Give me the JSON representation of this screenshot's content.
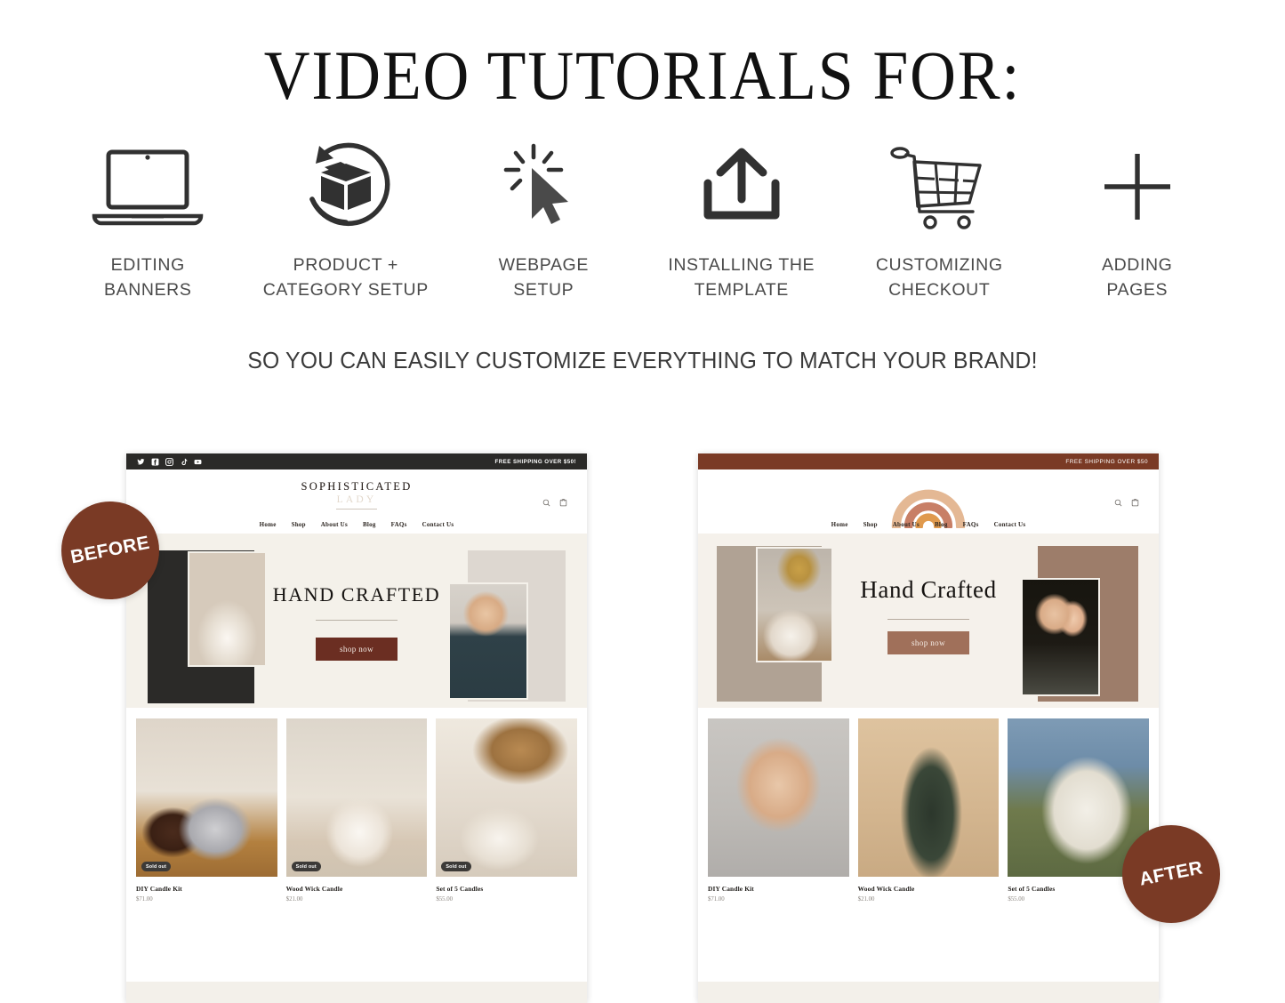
{
  "header": {
    "title": "VIDEO TUTORIALS FOR:",
    "subtitle": "SO YOU CAN EASILY CUSTOMIZE EVERYTHING TO MATCH YOUR BRAND!"
  },
  "features": [
    {
      "icon": "laptop-icon",
      "label": "EDITING\nBANNERS"
    },
    {
      "icon": "box-refresh-icon",
      "label": "PRODUCT +\nCATEGORY SETUP"
    },
    {
      "icon": "cursor-click-icon",
      "label": "WEBPAGE\nSETUP"
    },
    {
      "icon": "upload-icon",
      "label": "INSTALLING THE\nTEMPLATE"
    },
    {
      "icon": "shopping-cart-icon",
      "label": "CUSTOMIZING\nCHECKOUT"
    },
    {
      "icon": "plus-icon",
      "label": "ADDING\nPAGES"
    }
  ],
  "badges": {
    "before": "BEFORE",
    "after": "AFTER"
  },
  "colors": {
    "badge_brown": "#7a3a25",
    "before_bar": "#2b2a28",
    "after_bar": "#7a3a25",
    "before_button": "#6b2e22",
    "after_button": "#a0705a",
    "hero_bg": "#f4f1ea"
  },
  "before_site": {
    "announcement": "FREE SHIPPING OVER $50!",
    "socials": [
      "twitter-icon",
      "facebook-icon",
      "instagram-icon",
      "tiktok-icon",
      "youtube-icon"
    ],
    "logo_main": "SOPHISTICATED",
    "logo_sub": "LADY",
    "header_icons": [
      "search-icon",
      "bag-icon"
    ],
    "nav": [
      "Home",
      "Shop",
      "About Us",
      "Blog",
      "FAQs",
      "Contact Us"
    ],
    "hero": {
      "title": "HAND CRAFTED",
      "button": "shop now"
    },
    "products": [
      {
        "name": "DIY Candle Kit",
        "price": "$71.00",
        "badge": "Sold out"
      },
      {
        "name": "Wood Wick Candle",
        "price": "$21.00",
        "badge": "Sold out"
      },
      {
        "name": "Set of 5 Candles",
        "price": "$55.00",
        "badge": "Sold out"
      }
    ]
  },
  "after_site": {
    "announcement": "FREE SHIPPING OVER $50",
    "logo": "rainbow-arch-logo",
    "header_icons": [
      "search-icon",
      "bag-icon"
    ],
    "nav": [
      "Home",
      "Shop",
      "About Us",
      "Blog",
      "FAQs",
      "Contact Us"
    ],
    "hero": {
      "title": "Hand Crafted",
      "button": "shop now"
    },
    "products": [
      {
        "name": "DIY Candle Kit",
        "price": "$71.00"
      },
      {
        "name": "Wood Wick Candle",
        "price": "$21.00"
      },
      {
        "name": "Set of 5 Candles",
        "price": "$55.00"
      }
    ]
  }
}
